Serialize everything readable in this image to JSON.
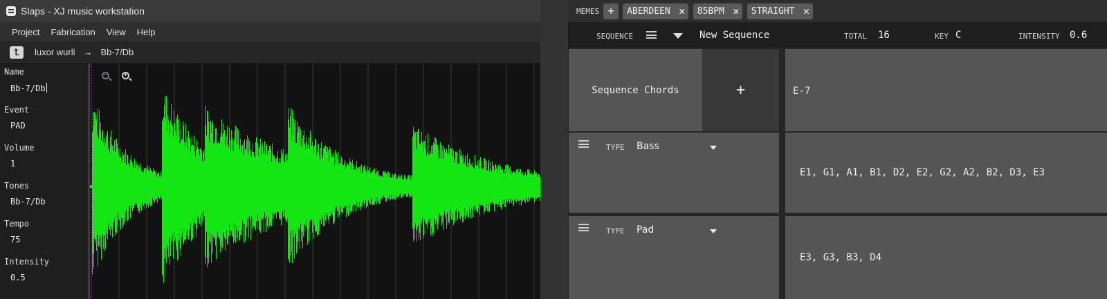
{
  "left_window": {
    "title": "Slaps - XJ music workstation",
    "menu": [
      "Project",
      "Fabrication",
      "View",
      "Help"
    ],
    "path": {
      "library": "luxor wurli",
      "arrow": "→",
      "item": "Bb-7/Db"
    },
    "properties": [
      {
        "label": "Name",
        "value": "Bb-7/Db"
      },
      {
        "label": "Event",
        "value": "PAD"
      },
      {
        "label": "Volume",
        "value": "1"
      },
      {
        "label": "Tones",
        "value": "Bb-7/Db"
      },
      {
        "label": "Tempo",
        "value": "75"
      },
      {
        "label": "Intensity",
        "value": "0.5"
      }
    ],
    "waveform": {
      "color": "#13e613",
      "background": "#121212",
      "gridline_color": "#3a3a3a",
      "playhead_color": "#b040d0",
      "zoom_out_icon": "zoom-out-icon",
      "zoom_in_icon": "zoom-in-icon"
    }
  },
  "right_window": {
    "memes": {
      "label": "MEMES",
      "add_label": "+",
      "chips": [
        "ABERDEEN",
        "85BPM",
        "STRAIGHT"
      ],
      "remove_label": "✕"
    },
    "sequence_bar": {
      "sequence_label": "SEQUENCE",
      "sequence_name": "New Sequence",
      "total_label": "TOTAL",
      "total_value": "16",
      "key_label": "KEY",
      "key_value": "C",
      "intensity_label": "INTENSITY",
      "intensity_value": "0.6"
    },
    "chords": {
      "title": "Sequence Chords",
      "add_label": "+",
      "value": "E-7"
    },
    "voices": [
      {
        "type_label": "TYPE",
        "type": "Bass",
        "notes": "E1, G1, A1, B1, D2, E2, G2, A2, B2, D3, E3"
      },
      {
        "type_label": "TYPE",
        "type": "Pad",
        "notes": "E3, G3, B3, D4"
      }
    ],
    "colors": {
      "cell": "#555555",
      "add_cell": "#383838",
      "divider": "#1a1a1a"
    }
  }
}
